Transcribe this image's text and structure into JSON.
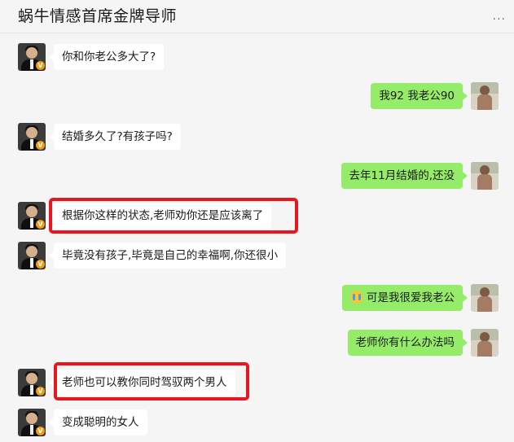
{
  "header": {
    "title": "蜗牛情感首席金牌导师",
    "more_icon": "more-icon",
    "more_text": "···"
  },
  "colors": {
    "outgoing_bubble": "#95ec69",
    "incoming_bubble": "#ffffff",
    "highlight_box": "#e8161e",
    "badge": "#f39c12"
  },
  "teacher_badge": "V",
  "messages": [
    {
      "sender": "teacher",
      "text": "你和你老公多大了?"
    },
    {
      "sender": "me",
      "text": "我92 我老公90"
    },
    {
      "sender": "teacher",
      "text": "结婚多久了?有孩子吗?"
    },
    {
      "sender": "me",
      "text": "去年11月结婚的,还没"
    },
    {
      "sender": "teacher",
      "text": "根据你这样的状态,老师劝你还是应该离了",
      "highlighted": true
    },
    {
      "sender": "teacher",
      "text": "毕竟没有孩子,毕竟是自己的幸福啊,你还很小"
    },
    {
      "sender": "me",
      "emoji": "crying-face-icon",
      "text": "可是我很爱我老公"
    },
    {
      "sender": "me",
      "text": "老师你有什么办法吗"
    },
    {
      "sender": "teacher",
      "text": "老师也可以教你同时驾驭两个男人",
      "highlighted": true
    },
    {
      "sender": "teacher",
      "text": "变成聪明的女人"
    }
  ]
}
